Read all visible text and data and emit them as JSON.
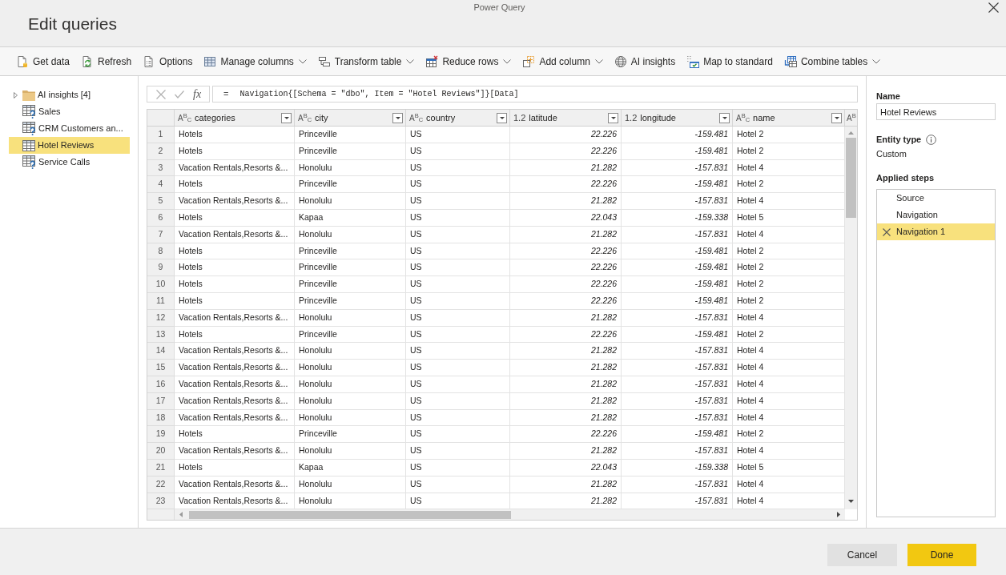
{
  "window": {
    "title": "Power Query",
    "heading": "Edit queries"
  },
  "toolbar": {
    "items": [
      {
        "label": "Get data",
        "dropdown": false
      },
      {
        "label": "Refresh",
        "dropdown": false
      },
      {
        "label": "Options",
        "dropdown": false
      },
      {
        "label": "Manage columns",
        "dropdown": true
      },
      {
        "label": "Transform table",
        "dropdown": true
      },
      {
        "label": "Reduce rows",
        "dropdown": true
      },
      {
        "label": "Add column",
        "dropdown": true
      },
      {
        "label": "AI insights",
        "dropdown": false
      },
      {
        "label": "Map to standard",
        "dropdown": false
      },
      {
        "label": "Combine tables",
        "dropdown": true
      }
    ]
  },
  "queries": {
    "items": [
      {
        "label": "AI insights [4]",
        "kind": "folder",
        "expanded": false,
        "selected": false
      },
      {
        "label": "Sales",
        "kind": "table-unknown",
        "selected": false
      },
      {
        "label": "CRM Customers an...",
        "kind": "table-unknown",
        "selected": false
      },
      {
        "label": "Hotel Reviews",
        "kind": "table",
        "selected": true
      },
      {
        "label": "Service Calls",
        "kind": "table-unknown",
        "selected": false
      }
    ]
  },
  "formula_bar": {
    "function_label": "fx",
    "operator": "=",
    "formula": "Navigation{[Schema = \"dbo\", Item = \"Hotel Reviews\"]}[Data]"
  },
  "table": {
    "columns": [
      {
        "kind": "text",
        "type_label": "A$^{B}$$_{C}$",
        "name": "categories"
      },
      {
        "kind": "text",
        "type_label": "A$^{B}$$_{C}$",
        "name": "city"
      },
      {
        "kind": "text",
        "type_label": "A$^{B}$$_{C}$",
        "name": "country"
      },
      {
        "kind": "number",
        "type_label": "1.2",
        "name": "latitude"
      },
      {
        "kind": "number",
        "type_label": "1.2",
        "name": "longitude"
      },
      {
        "kind": "text",
        "type_label": "A$^{B}$$_{C}$",
        "name": "name"
      },
      {
        "kind": "text",
        "type_label": "A$^{B}$"
      }
    ],
    "rows": [
      {
        "number": "1",
        "cells": [
          "Hotels",
          "Princeville",
          "US",
          "22.226",
          "-159.481",
          "Hotel 2"
        ]
      },
      {
        "number": "2",
        "cells": [
          "Hotels",
          "Princeville",
          "US",
          "22.226",
          "-159.481",
          "Hotel 2"
        ]
      },
      {
        "number": "3",
        "cells": [
          "Vacation Rentals,Resorts &...",
          "Honolulu",
          "US",
          "21.282",
          "-157.831",
          "Hotel 4"
        ]
      },
      {
        "number": "4",
        "cells": [
          "Hotels",
          "Princeville",
          "US",
          "22.226",
          "-159.481",
          "Hotel 2"
        ]
      },
      {
        "number": "5",
        "cells": [
          "Vacation Rentals,Resorts &...",
          "Honolulu",
          "US",
          "21.282",
          "-157.831",
          "Hotel 4"
        ]
      },
      {
        "number": "6",
        "cells": [
          "Hotels",
          "Kapaa",
          "US",
          "22.043",
          "-159.338",
          "Hotel 5"
        ]
      },
      {
        "number": "7",
        "cells": [
          "Vacation Rentals,Resorts &...",
          "Honolulu",
          "US",
          "21.282",
          "-157.831",
          "Hotel 4"
        ]
      },
      {
        "number": "8",
        "cells": [
          "Hotels",
          "Princeville",
          "US",
          "22.226",
          "-159.481",
          "Hotel 2"
        ]
      },
      {
        "number": "9",
        "cells": [
          "Hotels",
          "Princeville",
          "US",
          "22.226",
          "-159.481",
          "Hotel 2"
        ]
      },
      {
        "number": "10",
        "cells": [
          "Hotels",
          "Princeville",
          "US",
          "22.226",
          "-159.481",
          "Hotel 2"
        ]
      },
      {
        "number": "11",
        "cells": [
          "Hotels",
          "Princeville",
          "US",
          "22.226",
          "-159.481",
          "Hotel 2"
        ]
      },
      {
        "number": "12",
        "cells": [
          "Vacation Rentals,Resorts &...",
          "Honolulu",
          "US",
          "21.282",
          "-157.831",
          "Hotel 4"
        ]
      },
      {
        "number": "13",
        "cells": [
          "Hotels",
          "Princeville",
          "US",
          "22.226",
          "-159.481",
          "Hotel 2"
        ]
      },
      {
        "number": "14",
        "cells": [
          "Vacation Rentals,Resorts &...",
          "Honolulu",
          "US",
          "21.282",
          "-157.831",
          "Hotel 4"
        ]
      },
      {
        "number": "15",
        "cells": [
          "Vacation Rentals,Resorts &...",
          "Honolulu",
          "US",
          "21.282",
          "-157.831",
          "Hotel 4"
        ]
      },
      {
        "number": "16",
        "cells": [
          "Vacation Rentals,Resorts &...",
          "Honolulu",
          "US",
          "21.282",
          "-157.831",
          "Hotel 4"
        ]
      },
      {
        "number": "17",
        "cells": [
          "Vacation Rentals,Resorts &...",
          "Honolulu",
          "US",
          "21.282",
          "-157.831",
          "Hotel 4"
        ]
      },
      {
        "number": "18",
        "cells": [
          "Vacation Rentals,Resorts &...",
          "Honolulu",
          "US",
          "21.282",
          "-157.831",
          "Hotel 4"
        ]
      },
      {
        "number": "19",
        "cells": [
          "Hotels",
          "Princeville",
          "US",
          "22.226",
          "-159.481",
          "Hotel 2"
        ]
      },
      {
        "number": "20",
        "cells": [
          "Vacation Rentals,Resorts &...",
          "Honolulu",
          "US",
          "21.282",
          "-157.831",
          "Hotel 4"
        ]
      },
      {
        "number": "21",
        "cells": [
          "Hotels",
          "Kapaa",
          "US",
          "22.043",
          "-159.338",
          "Hotel 5"
        ]
      },
      {
        "number": "22",
        "cells": [
          "Vacation Rentals,Resorts &...",
          "Honolulu",
          "US",
          "21.282",
          "-157.831",
          "Hotel 4"
        ]
      },
      {
        "number": "23",
        "cells": [
          "Vacation Rentals,Resorts &...",
          "Honolulu",
          "US",
          "21.282",
          "-157.831",
          "Hotel 4"
        ]
      }
    ]
  },
  "properties": {
    "name_label": "Name",
    "name_value": "Hotel Reviews",
    "entity_type_label": "Entity type",
    "entity_type": "Custom",
    "steps_label": "Applied steps",
    "steps": [
      {
        "label": "Source",
        "selected": false
      },
      {
        "label": "Navigation",
        "selected": false
      },
      {
        "label": "Navigation 1",
        "selected": true
      }
    ]
  },
  "buttons": [
    {
      "label": "Cancel",
      "kind": "secondary"
    },
    {
      "label": "Done",
      "kind": "primary"
    }
  ]
}
